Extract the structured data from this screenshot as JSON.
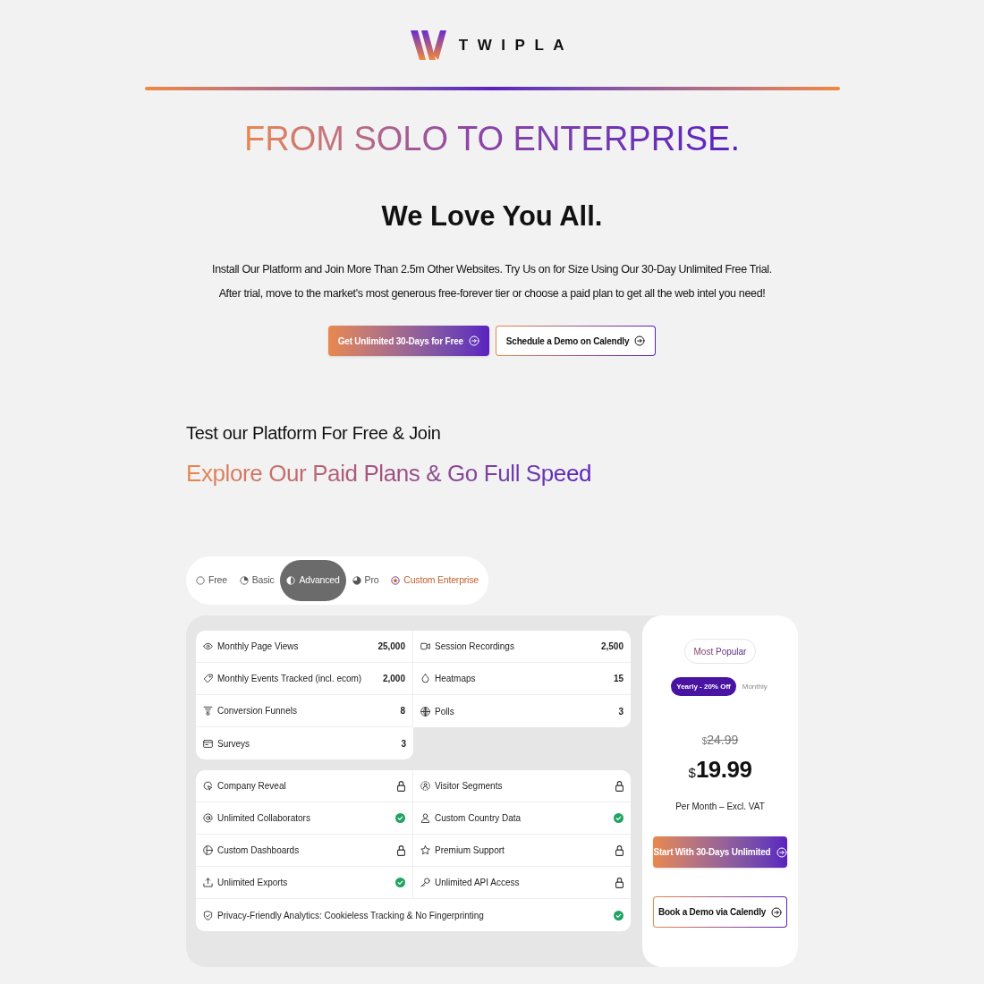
{
  "logo": {
    "wordmark": "TWIPLA"
  },
  "hero": {
    "headline": "FROM SOLO TO ENTERPRISE.",
    "subheadline": "We Love You All.",
    "intro_lines": [
      "Install Our Platform and Join More Than 2.5m Other Websites. Try Us on for Size Using Our 30-Day Unlimited Free Trial.",
      "After trial, move to the market's most generous free-forever tier or choose a paid plan to get all the web intel you need!"
    ],
    "buttons": [
      {
        "label": "Get Unlimited 30-Days for Free",
        "kind": "primary"
      },
      {
        "label": "Schedule a Demo on Calendly",
        "kind": "outline"
      }
    ]
  },
  "plans_section": {
    "title": "Test our Platform For Free & Join",
    "subtitle": "Explore Our Paid Plans & Go Full Speed"
  },
  "plan_tabs": [
    {
      "label": "Free",
      "selected": false,
      "kind": "standard"
    },
    {
      "label": "Basic",
      "selected": false,
      "kind": "standard"
    },
    {
      "label": "Advanced",
      "selected": true,
      "kind": "standard"
    },
    {
      "label": "Pro",
      "selected": false,
      "kind": "standard"
    },
    {
      "label": "Custom Enterprise",
      "selected": false,
      "kind": "featured"
    }
  ],
  "limits": [
    {
      "label": "Monthly Page Views",
      "value": "25,000"
    },
    {
      "label": "Session Recordings",
      "value": "2,500"
    },
    {
      "label": "Monthly Events Tracked (incl. ecom)",
      "value": "2,000"
    },
    {
      "label": "Heatmaps",
      "value": "15"
    },
    {
      "label": "Conversion Funnels",
      "value": "8"
    },
    {
      "label": "Polls",
      "value": "3"
    },
    {
      "label": "Surveys",
      "value": "3"
    }
  ],
  "features": [
    {
      "label": "Company Reveal",
      "included": false,
      "kind": "half"
    },
    {
      "label": "Visitor Segments",
      "included": false,
      "kind": "half"
    },
    {
      "label": "Unlimited Collaborators",
      "included": true,
      "kind": "half"
    },
    {
      "label": "Custom Country Data",
      "included": true,
      "kind": "half"
    },
    {
      "label": "Custom Dashboards",
      "included": false,
      "kind": "half"
    },
    {
      "label": "Premium Support",
      "included": false,
      "kind": "half"
    },
    {
      "label": "Unlimited Exports",
      "included": true,
      "kind": "half"
    },
    {
      "label": "Unlimited API Access",
      "included": false,
      "kind": "half"
    },
    {
      "label": "Privacy-Friendly Analytics: Cookieless Tracking & No Fingerprinting",
      "included": true,
      "kind": "wide"
    }
  ],
  "pricing": {
    "badge": "Most Popular",
    "billing_options": [
      {
        "label": "Yearly - 20% Off",
        "selected": true
      },
      {
        "label": "Monthly",
        "selected": false
      }
    ],
    "old_price": {
      "currency": "$",
      "amount": "24.99"
    },
    "price": {
      "currency": "$",
      "amount": "19.99"
    },
    "price_note": "Per Month – Excl. VAT",
    "buttons": [
      {
        "label": "Start With 30-Days Unlimited",
        "kind": "primary"
      },
      {
        "label": "Book a Demo via Calendly",
        "kind": "outline"
      }
    ]
  }
}
